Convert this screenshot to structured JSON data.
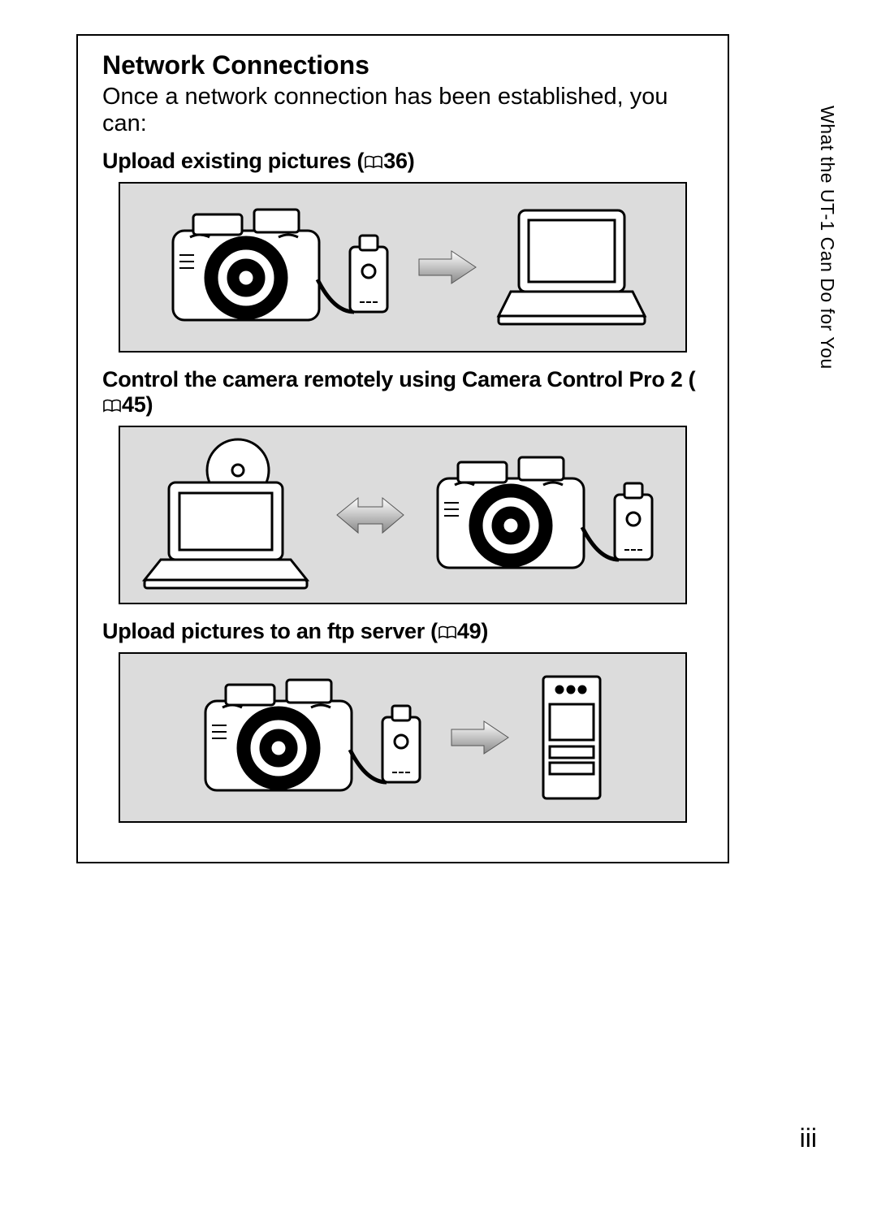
{
  "section_title": "Network Connections",
  "intro_text": "Once a network connection has been established, you can:",
  "features": [
    {
      "label_prefix": "Upload existing pictures (",
      "page_ref": "36",
      "label_suffix": ")"
    },
    {
      "label_prefix": "Control the camera remotely using Camera Control Pro 2 (",
      "page_ref": "45",
      "label_suffix": ")"
    },
    {
      "label_prefix": "Upload pictures to an ftp server (",
      "page_ref": "49",
      "label_suffix": ")"
    }
  ],
  "side_tab": "What the UT-1 Can Do for You",
  "page_number": "iii"
}
